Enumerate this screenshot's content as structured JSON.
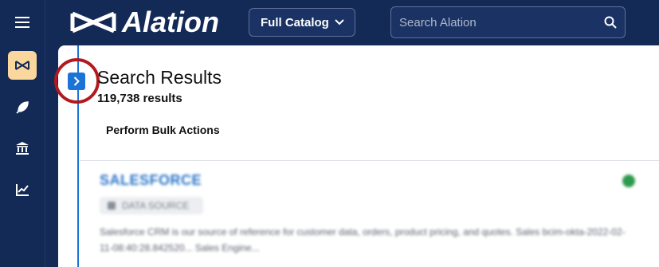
{
  "brand": {
    "name": "Alation"
  },
  "header": {
    "catalog_dropdown": "Full Catalog",
    "search_placeholder": "Search Alation"
  },
  "sidebar": {
    "items": [
      {
        "name": "menu",
        "icon": "hamburger-menu-icon",
        "active": false
      },
      {
        "name": "catalog",
        "icon": "alation-bowtie-icon",
        "active": true
      },
      {
        "name": "compose",
        "icon": "feather-quill-icon",
        "active": false
      },
      {
        "name": "sources",
        "icon": "institution-building-icon",
        "active": false
      },
      {
        "name": "analytics",
        "icon": "line-chart-icon",
        "active": false
      }
    ]
  },
  "main": {
    "title": "Search Results",
    "result_count": "119,738 results",
    "bulk_actions_label": "Perform Bulk Actions",
    "results": [
      {
        "name": "SALESFORCE",
        "type_label": "DATA SOURCE",
        "description": "Salesforce CRM is our source of reference for customer data, orders, product pricing, and quotes. Sales bcim-okta-2022-02-11-08:40:28.842520... Sales Engine..."
      }
    ]
  },
  "colors": {
    "nav_bg": "#132a57",
    "accent_blue": "#1a73d6",
    "active_nav": "#f9d79d",
    "annotation_red": "#b01a1f",
    "status_green": "#2e9a4e"
  }
}
